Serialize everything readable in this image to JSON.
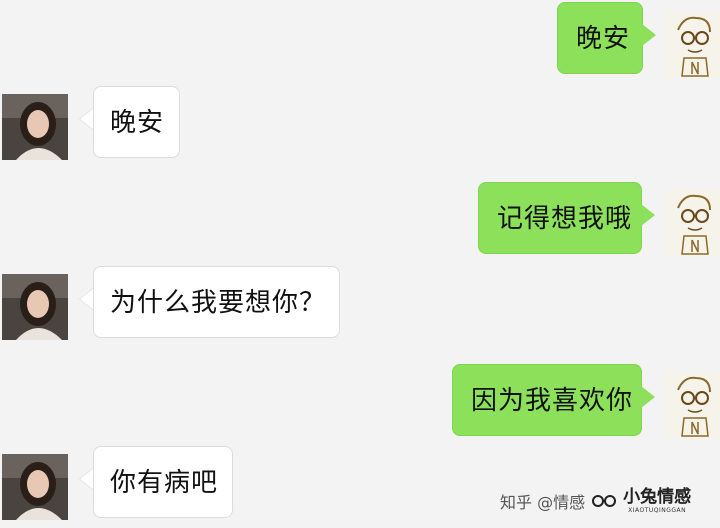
{
  "messages": [
    {
      "side": "right",
      "text": "晚安"
    },
    {
      "side": "left",
      "text": "晚安"
    },
    {
      "side": "right",
      "text": "记得想我哦"
    },
    {
      "side": "left",
      "text": "为什么我要想你？"
    },
    {
      "side": "right",
      "text": "因为我喜欢你"
    },
    {
      "side": "left",
      "text": "你有病吧"
    }
  ],
  "watermark": {
    "zhihu": "知乎 @情感",
    "brand": "小兔情感",
    "brand_sub": "XIAOTUQINGGAN"
  },
  "colors": {
    "background": "#f3f3f3",
    "outgoing_bubble": "#8ce05a",
    "incoming_bubble": "#ffffff"
  }
}
